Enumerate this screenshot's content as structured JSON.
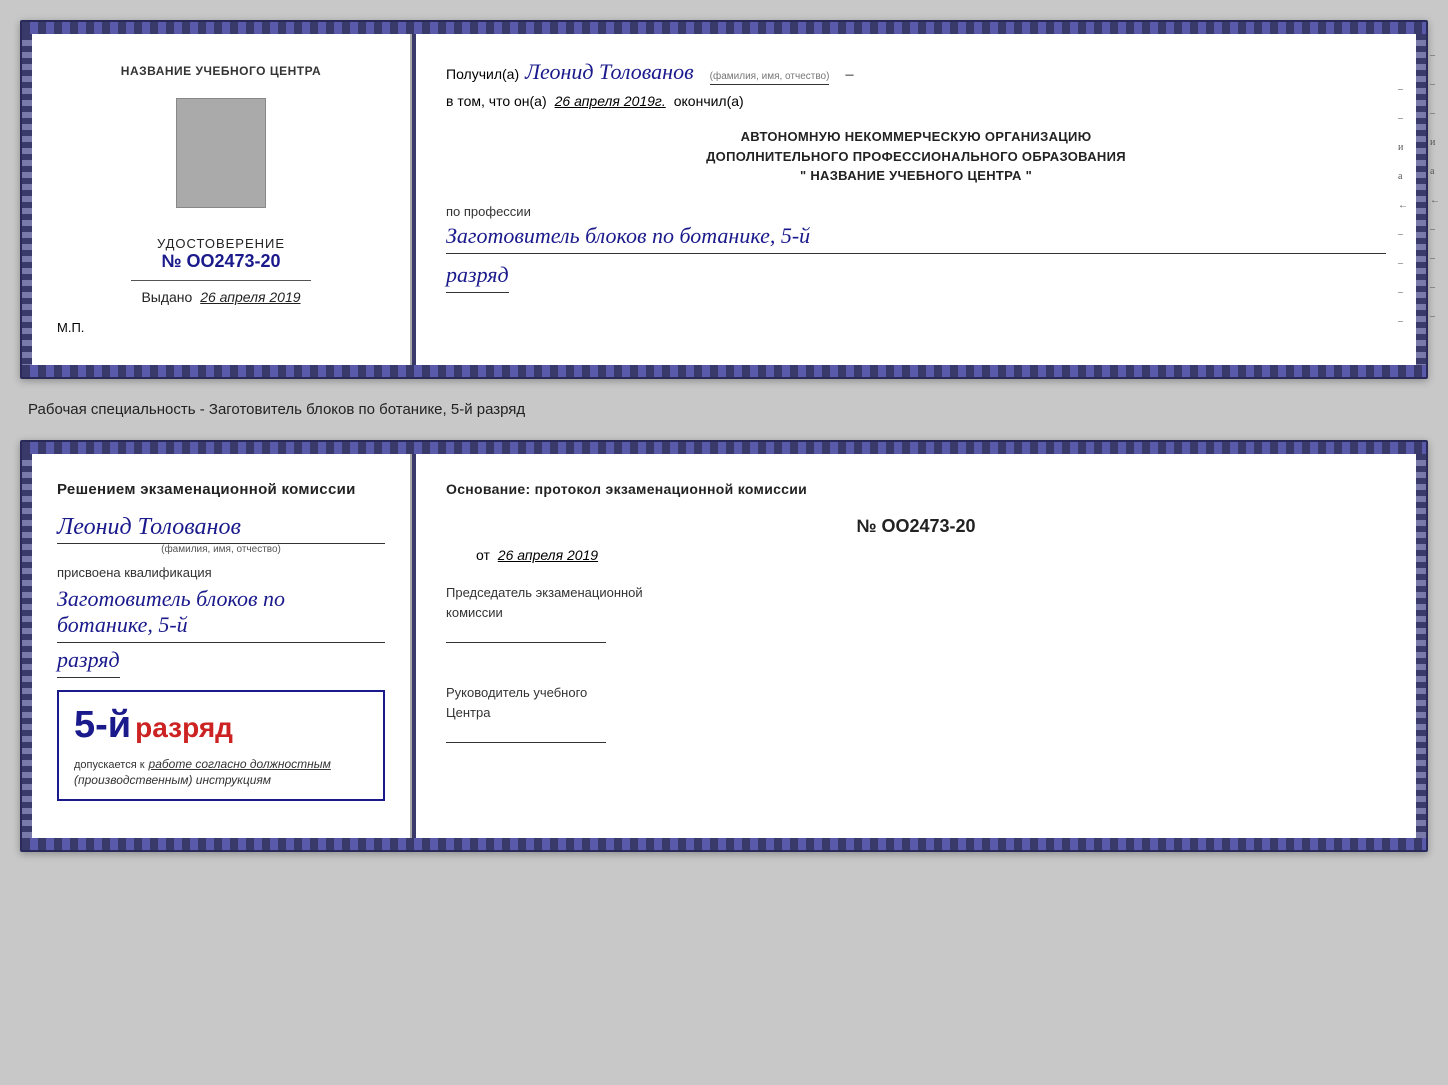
{
  "doc1": {
    "left": {
      "institution_label": "НАЗВАНИЕ УЧЕБНОГО ЦЕНТРА",
      "cert_label": "УДОСТОВЕРЕНИЕ",
      "cert_number": "№ OO2473-20",
      "issued_label": "Выдано",
      "issued_date": "26 апреля 2019",
      "mp_label": "М.П."
    },
    "right": {
      "received_prefix": "Получил(а)",
      "recipient_name": "Леонид Толованов",
      "recipient_sublabel": "(фамилия, имя, отчество)",
      "confirm_prefix": "в том, что он(а)",
      "confirm_date": "26 апреля 2019г.",
      "confirm_suffix": "окончил(а)",
      "org_line1": "АВТОНОМНУЮ НЕКОММЕРЧЕСКУЮ ОРГАНИЗАЦИЮ",
      "org_line2": "ДОПОЛНИТЕЛЬНОГО ПРОФЕССИОНАЛЬНОГО ОБРАЗОВАНИЯ",
      "org_line3": "\"  НАЗВАНИЕ УЧЕБНОГО ЦЕНТРА  \"",
      "profession_label": "по профессии",
      "profession_name": "Заготовитель блоков по ботанике, 5-й",
      "rank_text": "разряд"
    }
  },
  "specialty_text": "Рабочая специальность - Заготовитель блоков по ботанике, 5-й разряд",
  "doc2": {
    "left": {
      "decision_label": "Решением экзаменационной комиссии",
      "person_name": "Леонид Толованов",
      "person_sublabel": "(фамилия, имя, отчество)",
      "assigned_label": "присвоена квалификация",
      "qualification_line1": "Заготовитель блоков по ботанике, 5-й",
      "qualification_line2": "разряд",
      "box_number": "5-й",
      "box_rank": "разряд",
      "allowed_label": "допускается к",
      "allowed_text": "работе согласно должностным",
      "allowed_text2": "(производственным) инструкциям"
    },
    "right": {
      "basis_label": "Основание: протокол экзаменационной комиссии",
      "protocol_number": "№  OO2473-20",
      "date_prefix": "от",
      "date_value": "26 апреля 2019",
      "chairman_label": "Председатель экзаменационной",
      "chairman_label2": "комиссии",
      "center_head_label": "Руководитель учебного",
      "center_head_label2": "Центра"
    }
  }
}
